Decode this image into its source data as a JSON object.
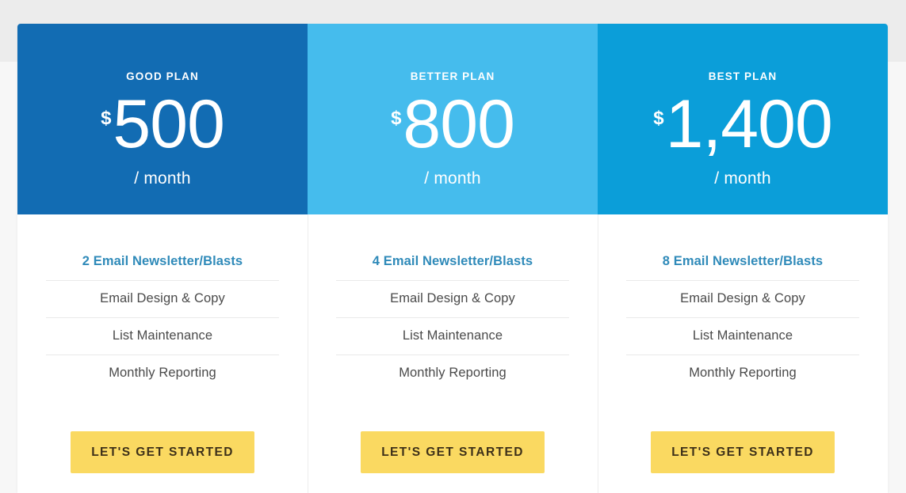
{
  "theme": {
    "page_background": "#ffffff",
    "top_band": "#ececec",
    "card_background": "#ffffff",
    "divider": "#e9e9e9",
    "feature_text": "#4a4a4a",
    "feature_primary": "#2f8ab9",
    "cta_background": "#fad961",
    "cta_text": "#3d3019"
  },
  "pricing_table": {
    "currency_symbol": "$",
    "plans": [
      {
        "name": "GOOD PLAN",
        "amount": "500",
        "period": "/ month",
        "header_color": "#126cb3",
        "features": [
          "2 Email Newsletter/Blasts",
          "Email Design & Copy",
          "List Maintenance",
          "Monthly Reporting"
        ],
        "cta_label": "LET'S GET STARTED"
      },
      {
        "name": "BETTER PLAN",
        "amount": "800",
        "period": "/ month",
        "header_color": "#45bced",
        "features": [
          "4 Email Newsletter/Blasts",
          "Email Design & Copy",
          "List Maintenance",
          "Monthly Reporting"
        ],
        "cta_label": "LET'S GET STARTED"
      },
      {
        "name": "BEST PLAN",
        "amount": "1,400",
        "period": "/ month",
        "header_color": "#0b9ed9",
        "features": [
          "8 Email Newsletter/Blasts",
          "Email Design & Copy",
          "List Maintenance",
          "Monthly Reporting"
        ],
        "cta_label": "LET'S GET STARTED"
      }
    ]
  }
}
